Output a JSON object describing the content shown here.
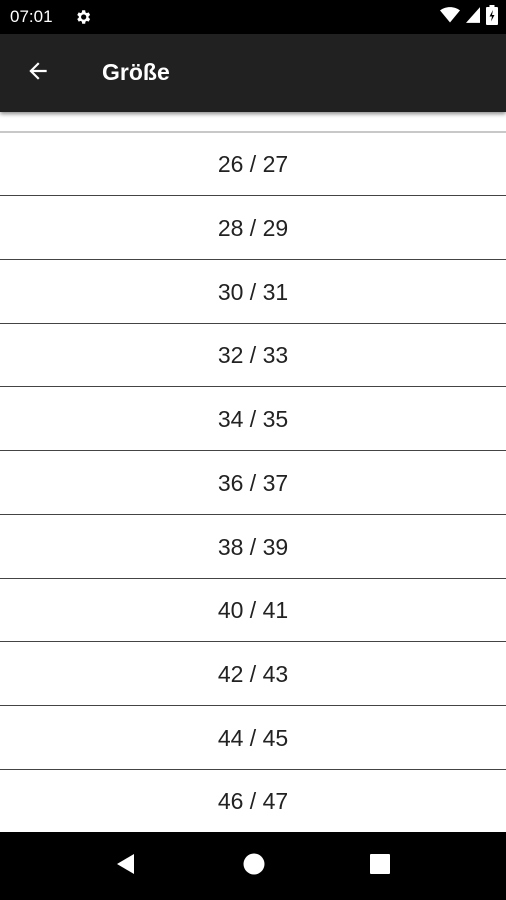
{
  "status_bar": {
    "time": "07:01",
    "icons": [
      "gear-icon",
      "wifi-icon",
      "signal-icon",
      "battery-icon"
    ]
  },
  "toolbar": {
    "title": "Größe",
    "back_icon": "arrow-left-icon",
    "background": "#212121"
  },
  "sizes": [
    "26 / 27",
    "28 / 29",
    "30 / 31",
    "32 / 33",
    "34 / 35",
    "36 / 37",
    "38 / 39",
    "40 / 41",
    "42 / 43",
    "44 / 45",
    "46 / 47"
  ],
  "nav_bar": {
    "icons": [
      "back-triangle-icon",
      "home-circle-icon",
      "recents-square-icon"
    ]
  }
}
